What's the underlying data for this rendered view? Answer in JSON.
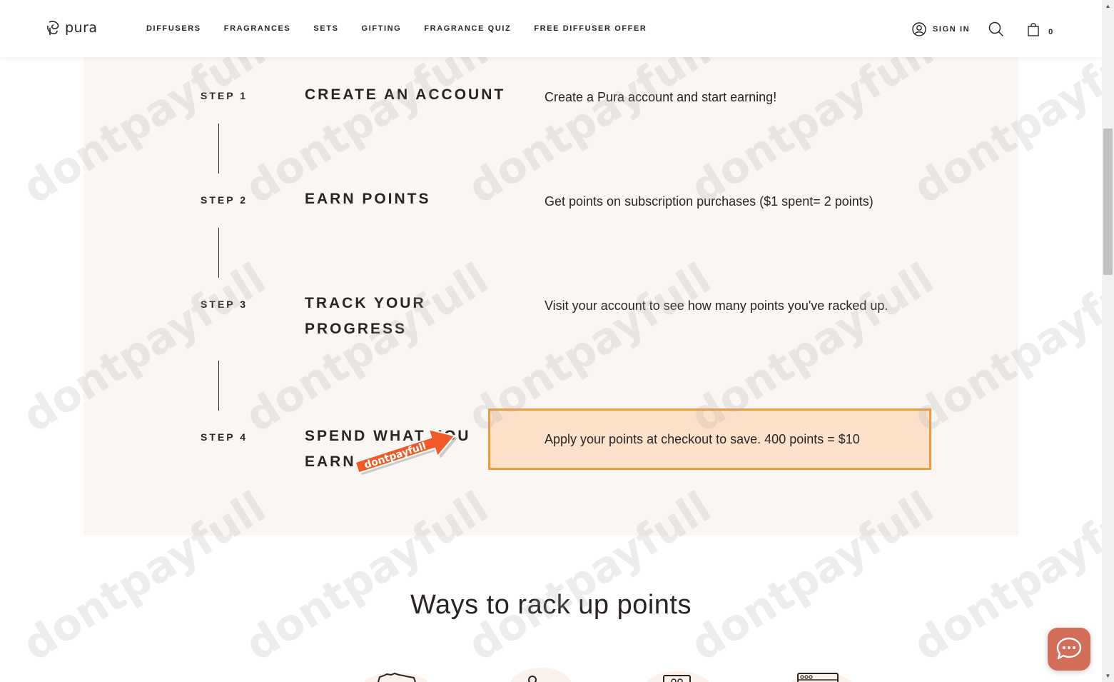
{
  "header": {
    "logo_text": "pura",
    "nav": [
      "DIFFUSERS",
      "FRAGRANCES",
      "SETS",
      "GIFTING",
      "FRAGRANCE QUIZ",
      "FREE DIFFUSER OFFER"
    ],
    "sign_in": "SIGN IN",
    "cart_count": "0"
  },
  "steps": [
    {
      "label": "STEP 1",
      "title": "CREATE AN ACCOUNT",
      "desc": "Create a Pura account and start earning!"
    },
    {
      "label": "STEP 2",
      "title": "EARN POINTS",
      "desc": "Get points on subscription purchases ($1 spent= 2 points)"
    },
    {
      "label": "STEP 3",
      "title": "TRACK YOUR PROGRESS",
      "desc": "Visit your account to see how many points you've racked up."
    },
    {
      "label": "STEP 4",
      "title": "SPEND WHAT YOU EARN",
      "desc": "Apply your points at checkout to save. 400 points = $10"
    }
  ],
  "promo_arrow_text": "dontpayfull",
  "watermark_text": "dontpayfull",
  "section_title": "Ways to rack up points",
  "colors": {
    "panel_bg": "#faf6f3",
    "highlight_bg": "#fde2cb",
    "highlight_border": "#ef9a3c",
    "arrow": "#f15a24",
    "chat": "#d36e58",
    "text": "#2b2522"
  }
}
